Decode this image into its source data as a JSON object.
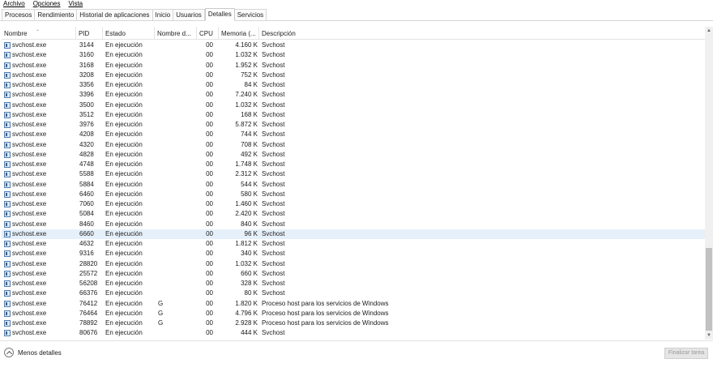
{
  "menu": [
    {
      "label": "Archivo"
    },
    {
      "label": "Opciones"
    },
    {
      "label": "Vista"
    }
  ],
  "tabs": [
    {
      "label": "Procesos",
      "active": false
    },
    {
      "label": "Rendimiento",
      "active": false
    },
    {
      "label": "Historial de aplicaciones",
      "active": false
    },
    {
      "label": "Inicio",
      "active": false
    },
    {
      "label": "Usuarios",
      "active": false
    },
    {
      "label": "Detalles",
      "active": true
    },
    {
      "label": "Servicios",
      "active": false
    }
  ],
  "columns": [
    "Nombre",
    "PID",
    "Estado",
    "Nombre d...",
    "CPU",
    "Memoria (...",
    "Descripción"
  ],
  "rows": [
    [
      "svchost.exe",
      "3144",
      "En ejecución",
      "",
      "00",
      "4.160 K",
      "Svchost"
    ],
    [
      "svchost.exe",
      "3160",
      "En ejecución",
      "",
      "00",
      "1.032 K",
      "Svchost"
    ],
    [
      "svchost.exe",
      "3168",
      "En ejecución",
      "",
      "00",
      "1.952 K",
      "Svchost"
    ],
    [
      "svchost.exe",
      "3208",
      "En ejecución",
      "",
      "00",
      "752 K",
      "Svchost"
    ],
    [
      "svchost.exe",
      "3356",
      "En ejecución",
      "",
      "00",
      "84 K",
      "Svchost"
    ],
    [
      "svchost.exe",
      "3396",
      "En ejecución",
      "",
      "00",
      "7.240 K",
      "Svchost"
    ],
    [
      "svchost.exe",
      "3500",
      "En ejecución",
      "",
      "00",
      "1.032 K",
      "Svchost"
    ],
    [
      "svchost.exe",
      "3512",
      "En ejecución",
      "",
      "00",
      "168 K",
      "Svchost"
    ],
    [
      "svchost.exe",
      "3976",
      "En ejecución",
      "",
      "00",
      "5.872 K",
      "Svchost"
    ],
    [
      "svchost.exe",
      "4208",
      "En ejecución",
      "",
      "00",
      "744 K",
      "Svchost"
    ],
    [
      "svchost.exe",
      "4320",
      "En ejecución",
      "",
      "00",
      "708 K",
      "Svchost"
    ],
    [
      "svchost.exe",
      "4828",
      "En ejecución",
      "",
      "00",
      "492 K",
      "Svchost"
    ],
    [
      "svchost.exe",
      "4748",
      "En ejecución",
      "",
      "00",
      "1.748 K",
      "Svchost"
    ],
    [
      "svchost.exe",
      "5588",
      "En ejecución",
      "",
      "00",
      "2.312 K",
      "Svchost"
    ],
    [
      "svchost.exe",
      "5884",
      "En ejecución",
      "",
      "00",
      "544 K",
      "Svchost"
    ],
    [
      "svchost.exe",
      "6460",
      "En ejecución",
      "",
      "00",
      "580 K",
      "Svchost"
    ],
    [
      "svchost.exe",
      "7060",
      "En ejecución",
      "",
      "00",
      "1.460 K",
      "Svchost"
    ],
    [
      "svchost.exe",
      "5084",
      "En ejecución",
      "",
      "00",
      "2.420 K",
      "Svchost"
    ],
    [
      "svchost.exe",
      "8460",
      "En ejecución",
      "",
      "00",
      "840 K",
      "Svchost"
    ],
    [
      "svchost.exe",
      "6660",
      "En ejecución",
      "",
      "00",
      "96 K",
      "Svchost"
    ],
    [
      "svchost.exe",
      "4632",
      "En ejecución",
      "",
      "00",
      "1.812 K",
      "Svchost"
    ],
    [
      "svchost.exe",
      "9316",
      "En ejecución",
      "",
      "00",
      "340 K",
      "Svchost"
    ],
    [
      "svchost.exe",
      "28820",
      "En ejecución",
      "",
      "00",
      "1.032 K",
      "Svchost"
    ],
    [
      "svchost.exe",
      "25572",
      "En ejecución",
      "",
      "00",
      "660 K",
      "Svchost"
    ],
    [
      "svchost.exe",
      "56208",
      "En ejecución",
      "",
      "00",
      "328 K",
      "Svchost"
    ],
    [
      "svchost.exe",
      "66376",
      "En ejecución",
      "",
      "00",
      "80 K",
      "Svchost"
    ],
    [
      "svchost.exe",
      "76412",
      "En ejecución",
      "G",
      "00",
      "1.820 K",
      "Proceso host para los servicios de Windows"
    ],
    [
      "svchost.exe",
      "76464",
      "En ejecución",
      "G",
      "00",
      "4.796 K",
      "Proceso host para los servicios de Windows"
    ],
    [
      "svchost.exe",
      "78892",
      "En ejecución",
      "G",
      "00",
      "2.928 K",
      "Proceso host para los servicios de Windows"
    ],
    [
      "svchost.exe",
      "80676",
      "En ejecución",
      "",
      "00",
      "444 K",
      "Svchost"
    ]
  ],
  "selected_row": 19,
  "footer": {
    "less_details": "Menos detalles",
    "end_task": "Finalizar tarea"
  }
}
